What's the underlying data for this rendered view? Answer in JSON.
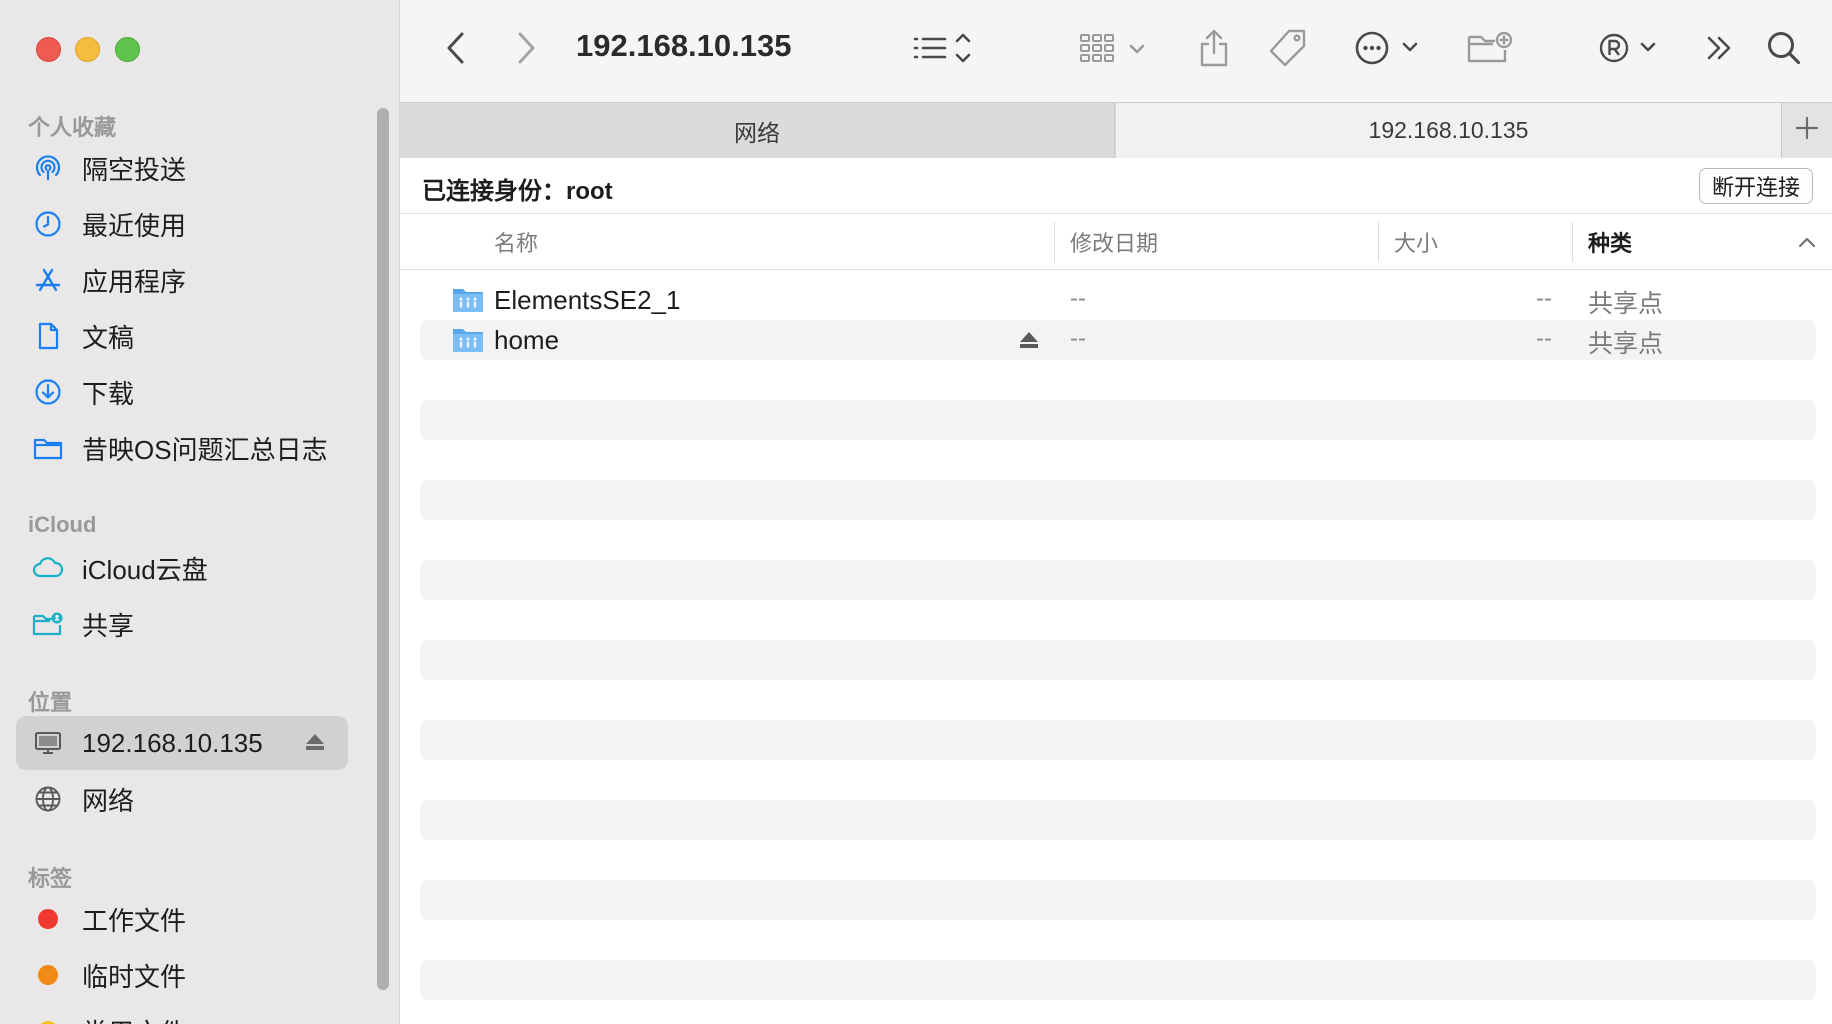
{
  "window": {
    "title": "192.168.10.135"
  },
  "sidebar": {
    "sections": {
      "favorites": "个人收藏",
      "icloud": "iCloud",
      "locations": "位置",
      "tags": "标签"
    },
    "favorites": [
      {
        "label": "隔空投送",
        "icon": "airdrop-icon"
      },
      {
        "label": "最近使用",
        "icon": "clock-icon"
      },
      {
        "label": "应用程序",
        "icon": "applications-icon"
      },
      {
        "label": "文稿",
        "icon": "document-icon"
      },
      {
        "label": "下载",
        "icon": "download-icon"
      },
      {
        "label": "昔映OS问题汇总日志",
        "icon": "folder-icon"
      }
    ],
    "icloud": [
      {
        "label": "iCloud云盘",
        "icon": "cloud-icon"
      },
      {
        "label": "共享",
        "icon": "shared-folder-icon"
      }
    ],
    "locations": [
      {
        "label": "192.168.10.135",
        "icon": "server-icon",
        "selected": true
      },
      {
        "label": "网络",
        "icon": "globe-icon"
      }
    ],
    "tags": [
      {
        "label": "工作文件",
        "color": "#f03a30"
      },
      {
        "label": "临时文件",
        "color": "#f08a14"
      },
      {
        "label": "常用文件",
        "color": "#f5c318"
      }
    ]
  },
  "toolbar": {
    "icons": [
      "back-icon",
      "forward-icon",
      "list-view-icon",
      "grid-view-icon",
      "share-icon",
      "tag-icon",
      "more-icon",
      "new-folder-icon",
      "registered-icon",
      "overflow-icon",
      "search-icon"
    ]
  },
  "tabs": [
    {
      "label": "网络",
      "active": false
    },
    {
      "label": "192.168.10.135",
      "active": true
    }
  ],
  "connection": {
    "label": "已连接身份：root",
    "disconnect_label": "断开连接"
  },
  "columns": {
    "name": "名称",
    "modified": "修改日期",
    "size": "大小",
    "kind": "种类"
  },
  "files": [
    {
      "name": "ElementsSE2_1",
      "modified": "--",
      "size": "--",
      "kind": "共享点",
      "ejectable": false
    },
    {
      "name": "home",
      "modified": "--",
      "size": "--",
      "kind": "共享点",
      "ejectable": true
    }
  ],
  "colors": {
    "accent": "#1a7ff0",
    "sidebar_bg": "#e9e7e8",
    "folder_blue": "#6fb5f3"
  }
}
